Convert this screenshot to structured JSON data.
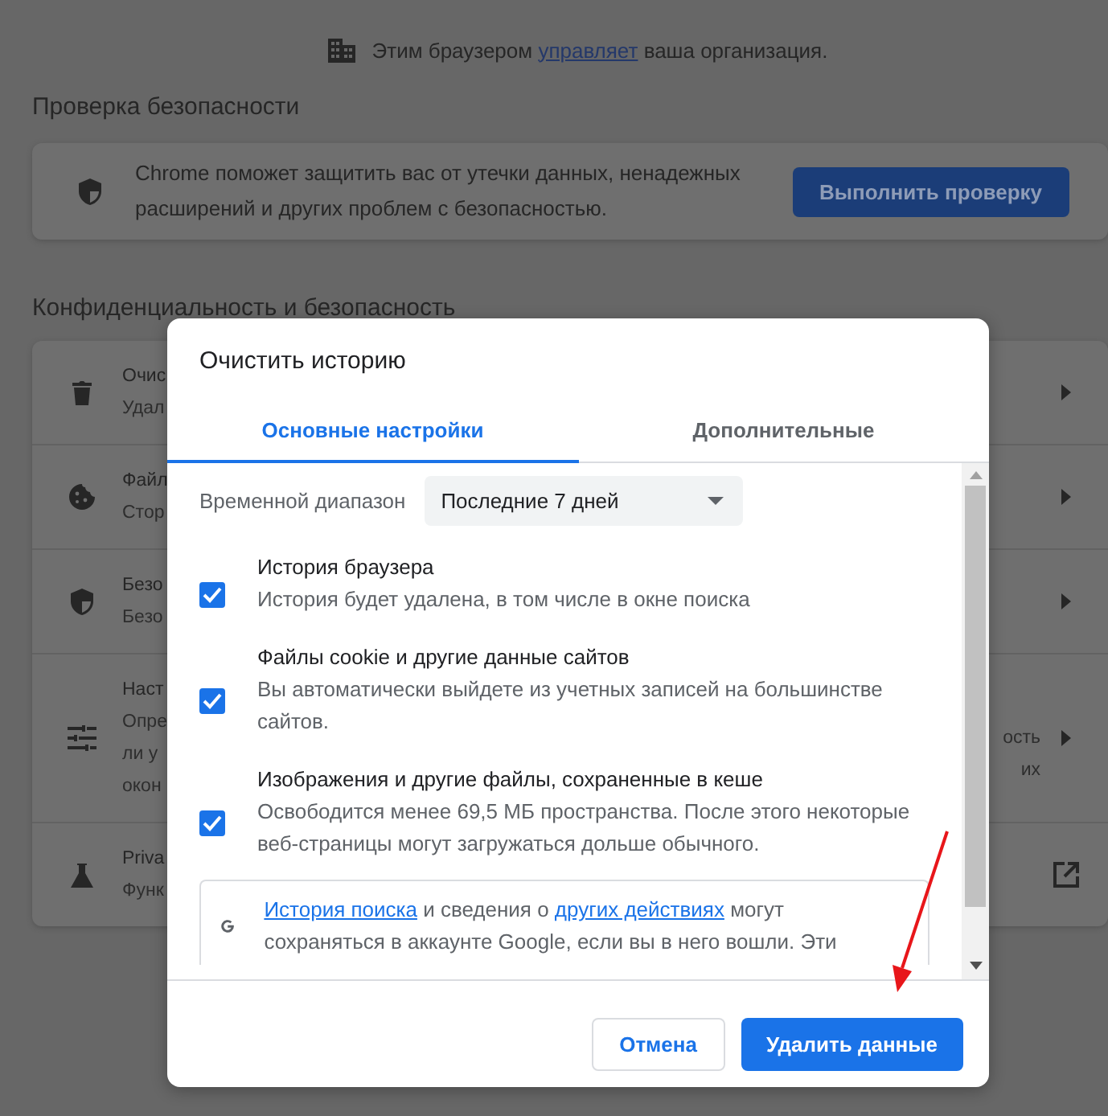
{
  "managed_notice": {
    "segments": [
      {
        "text": "Этим браузером ",
        "kind": "text"
      },
      {
        "text": "управляет",
        "kind": "link"
      },
      {
        "text": " ваша организация.",
        "kind": "text"
      }
    ]
  },
  "safety_check": {
    "heading": "Проверка безопасности",
    "description": "Chrome поможет защитить вас от утечки данных, ненадежных расширений и других проблем с безопасностью.",
    "button": "Выполнить проверку"
  },
  "privacy": {
    "heading": "Конфиденциальность и безопасность",
    "rows": [
      {
        "kind": "submenu",
        "title": "Очис",
        "lines": [
          "Удал"
        ],
        "right_lines": []
      },
      {
        "kind": "submenu",
        "title": "Файл",
        "lines": [
          "Стор"
        ],
        "right_lines": []
      },
      {
        "kind": "submenu",
        "title": "Безо",
        "lines": [
          "Безо"
        ],
        "right_lines": []
      },
      {
        "kind": "submenu",
        "title": "Наст",
        "lines": [
          "Опре",
          "ли у",
          "окон"
        ],
        "right_lines": [
          "ость",
          "их"
        ]
      },
      {
        "kind": "external",
        "title": "Priva",
        "lines": [
          "Функ"
        ],
        "right_lines": []
      }
    ]
  },
  "dialog": {
    "title": "Очистить историю",
    "tabs": [
      {
        "label": "Основные настройки",
        "selected": true
      },
      {
        "label": "Дополнительные",
        "selected": false
      }
    ],
    "time_range": {
      "label": "Временной диапазон",
      "value": "Последние 7 дней"
    },
    "items": [
      {
        "title": "История браузера",
        "description": "История будет удалена, в том числе в окне поиска",
        "checked": true
      },
      {
        "title": "Файлы cookie и другие данные сайтов",
        "description": "Вы автоматически выйдете из учетных записей на большинстве сайтов.",
        "checked": true
      },
      {
        "title": "Изображения и другие файлы, сохраненные в кеше",
        "description": "Освободится менее 69,5 МБ пространства. После этого некоторые веб-страницы могут загружаться дольше обычного.",
        "checked": true
      }
    ],
    "google_note": {
      "segments": [
        {
          "text": "История поиска",
          "kind": "link"
        },
        {
          "text": " и сведения о ",
          "kind": "text"
        },
        {
          "text": "других действиях",
          "kind": "link"
        },
        {
          "text": " могут сохраняться в аккаунте Google, если вы в него вошли. Эти",
          "kind": "text"
        }
      ]
    },
    "buttons": [
      {
        "label": "Отмена",
        "kind": "secondary"
      },
      {
        "label": "Удалить данные",
        "kind": "primary"
      }
    ]
  }
}
